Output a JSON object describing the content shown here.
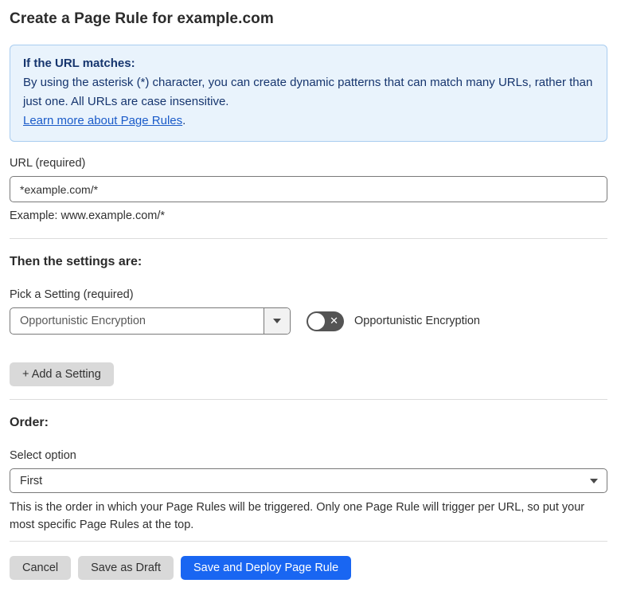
{
  "page": {
    "title": "Create a Page Rule for example.com"
  },
  "info_box": {
    "heading": "If the URL matches:",
    "body": "By using the asterisk (*) character, you can create dynamic patterns that can match many URLs, rather than just one. All URLs are case insensitive.",
    "link_label": "Learn more about Page Rules",
    "link_suffix": "."
  },
  "url_section": {
    "label": "URL (required)",
    "input_value": "*example.com/*",
    "helper": "Example: www.example.com/*"
  },
  "settings_section": {
    "heading": "Then the settings are:",
    "picker_label": "Pick a Setting (required)",
    "picker_value": "Opportunistic Encryption",
    "toggle_state": "off",
    "toggle_icon": "✕",
    "toggle_label": "Opportunistic Encryption",
    "add_setting_label": "+ Add a Setting"
  },
  "order_section": {
    "heading": "Order:",
    "select_label": "Select option",
    "select_value": "First",
    "helper": "This is the order in which your Page Rules will be triggered. Only one Page Rule will trigger per URL, so put your most specific Page Rules at the top."
  },
  "footer": {
    "cancel_label": "Cancel",
    "save_draft_label": "Save as Draft",
    "save_deploy_label": "Save and Deploy Page Rule"
  },
  "colors": {
    "accent_blue": "#1966f2",
    "info_bg": "#e9f3fc",
    "info_border": "#a9cdf0",
    "info_text": "#16356e",
    "link_blue": "#1a5bc9",
    "toggle_off": "#545454",
    "button_gray": "#d9d9d9"
  }
}
